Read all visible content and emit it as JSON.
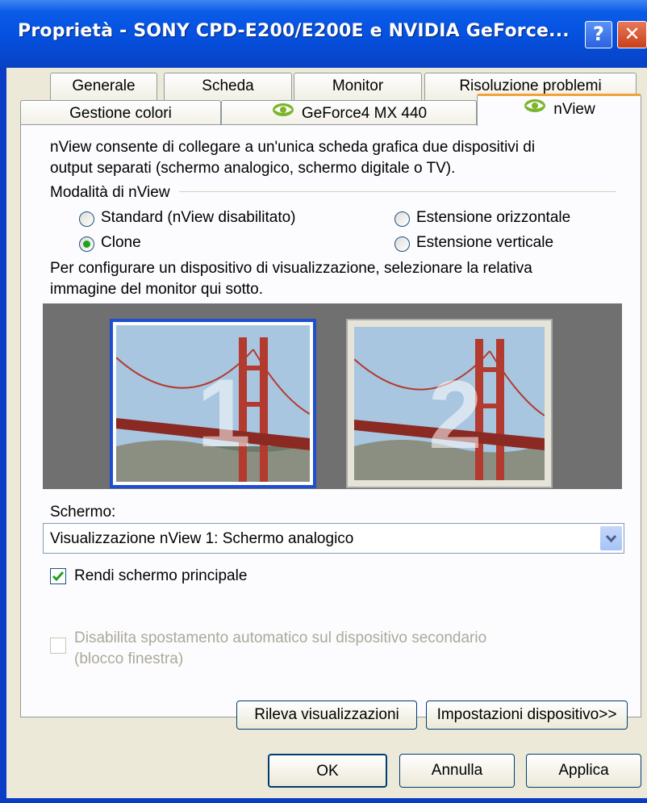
{
  "window": {
    "title": "Proprietà - SONY CPD-E200/E200E e NVIDIA GeForce...",
    "help_glyph": "?",
    "close_glyph": "✕"
  },
  "tabs_row1": [
    "Generale",
    "Scheda",
    "Monitor",
    "Risoluzione problemi"
  ],
  "tabs_row2": [
    "Gestione colori",
    "GeForce4 MX 440",
    "nView"
  ],
  "active_tab": "nView",
  "panel": {
    "description_line1": "nView consente di collegare a un'unica scheda grafica due dispositivi di",
    "description_line2": "output separati (schermo analogico, schermo digitale o TV).",
    "mode_group_label": "Modalità di nView",
    "modes": [
      {
        "label": "Standard (nView disabilitato)",
        "selected": false
      },
      {
        "label": "Estensione orizzontale",
        "selected": false
      },
      {
        "label": "Clone",
        "selected": true
      },
      {
        "label": "Estensione verticale",
        "selected": false
      }
    ],
    "config_line1": "Per configurare un dispositivo di visualizzazione, selezionare la relativa",
    "config_line2": "immagine del monitor qui sotto.",
    "monitors": [
      {
        "number": "1",
        "selected": true
      },
      {
        "number": "2",
        "selected": false
      }
    ],
    "screen_label": "Schermo:",
    "screen_select_value": "Visualizzazione nView 1: Schermo analogico",
    "primary_checkbox": {
      "label": "Rendi schermo principale",
      "checked": true
    },
    "disable_checkbox": {
      "label_line1": "Disabilita spostamento automatico sul dispositivo secondario",
      "label_line2": "(blocco finestra)",
      "checked": false,
      "enabled": false
    },
    "detect_button": "Rileva visualizzazioni",
    "device_settings_button": "Impostazioni dispositivo>>"
  },
  "footer": {
    "ok": "OK",
    "cancel": "Annulla",
    "apply": "Applica"
  },
  "colors": {
    "titlebar": "#0550de",
    "dialog_bg": "#ece9d8",
    "tab_highlight": "#f2a23a",
    "selected_monitor": "#1f4fd0"
  }
}
